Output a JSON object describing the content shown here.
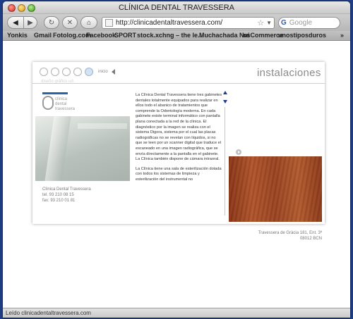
{
  "browser": {
    "window_title": "CLÍNICA DENTAL TRAVESSERA",
    "url": "http://clinicadentaltravessera.com/",
    "search_placeholder": "Google",
    "bookmarks": [
      "Yonkis",
      "Gmail",
      "Fotolog.com",
      "Facebook",
      "SPORT",
      "stock.xchng – the le...",
      "Muchachada Nui",
      "osCommerce",
      "unostiposduros"
    ],
    "bookmarks_overflow": "»",
    "status": "Leído clinicadentaltravessera.com"
  },
  "site": {
    "nav_label": "inicio",
    "faded_text": "diseño gráfico ud.",
    "heading": "instalaciones",
    "logo_text": "clínica\ndental\ntravessera",
    "body_paragraphs": [
      "La Clínica Dental Travessera tiene tres gabinetes dentales totalmente equipados para realizar en ellos todo el abanico de tratamientos que comprende la Odontología moderna. En cada gabinete existe terminal informático con pantalla plana conectada a la red de la clínica. El diagnóstico por la imagen se realiza con el sistema Digora, sistema por el cual las placas radiográficas no se revelan con líquidos, si no que se leen por un scanner digital que traduce el escaneado en una imagen radiográfica, que se envía directamente a la pantalla en el gabinete. La Clínica también dispone de cámara intraoral.",
      "La Clínica tiene una sala de esterilización dotada con todos los sistemas de limpieza y esterilización del instrumental no"
    ],
    "address_left": [
      "Clínica Dental Travessera",
      "tel. 93 210 08 15",
      "fax: 93 210 01 81"
    ],
    "address_right": [
      "Travessera de Gràcia 181, Ent. 3ª",
      "08012 BCN"
    ]
  }
}
